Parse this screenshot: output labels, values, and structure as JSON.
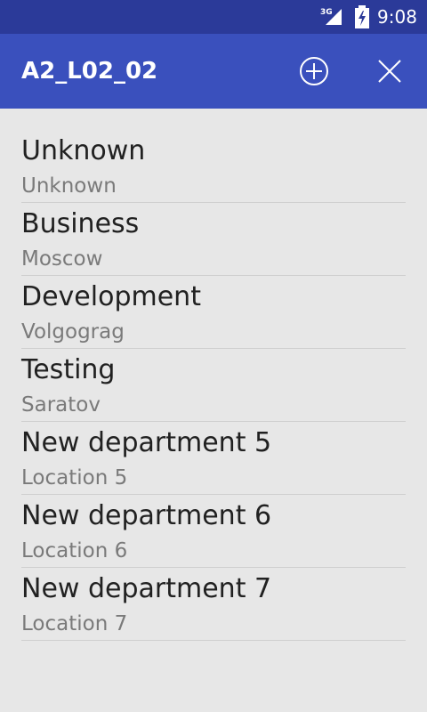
{
  "status_bar": {
    "network": "3G",
    "time": "9:08"
  },
  "app_bar": {
    "title": "A2_L02_02",
    "actions": [
      {
        "icon": "add-circle-icon"
      },
      {
        "icon": "close-icon"
      }
    ],
    "color": "#3a50bd"
  },
  "departments": [
    {
      "name": "Unknown",
      "location": "Unknown"
    },
    {
      "name": "Business",
      "location": "Moscow"
    },
    {
      "name": "Development",
      "location": "Volgograg"
    },
    {
      "name": "Testing",
      "location": "Saratov"
    },
    {
      "name": "New department 5",
      "location": "Location 5"
    },
    {
      "name": "New department 6",
      "location": "Location 6"
    },
    {
      "name": "New department 7",
      "location": "Location 7"
    }
  ]
}
